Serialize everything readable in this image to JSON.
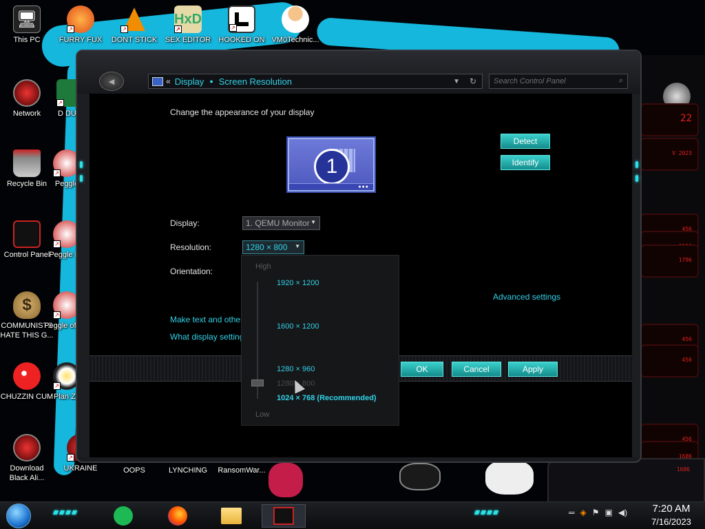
{
  "desktop": {
    "icons": [
      {
        "label": "This PC",
        "icon": "this-pc-icon",
        "glyph": "🖥"
      },
      {
        "label": "FURRY FUX",
        "icon": "firefox-icon",
        "glyph": "🦊"
      },
      {
        "label": "DONT STICK",
        "icon": "vlc-icon",
        "glyph": "🔺"
      },
      {
        "label": "SEX EDITOR",
        "icon": "hxd-icon",
        "glyph": "H"
      },
      {
        "label": "HOOKED ON",
        "icon": "game-icon",
        "glyph": "▞"
      },
      {
        "label": "VM0Technic...",
        "icon": "doctor-icon",
        "glyph": "👨"
      },
      {
        "label": "Network",
        "icon": "network-icon",
        "glyph": "◉"
      },
      {
        "label": "D DUM",
        "icon": "app-icon",
        "glyph": "▣"
      },
      {
        "label": "Recycle Bin",
        "icon": "recycle-bin-icon",
        "glyph": "🗑"
      },
      {
        "label": "Peggle",
        "icon": "peggle-icon",
        "glyph": "◐"
      },
      {
        "label": "Control Panel",
        "icon": "control-panel-icon",
        "glyph": "▤"
      },
      {
        "label": "Peggle De",
        "icon": "peggle-icon",
        "glyph": "◐"
      },
      {
        "label": "COMMUNISTS HATE THIS G...",
        "icon": "money-bag-icon",
        "glyph": "💰"
      },
      {
        "label": "Peggle of Wa",
        "icon": "peggle-icon",
        "glyph": "◐"
      },
      {
        "label": "CHUZZIN CUM",
        "icon": "chuzzle-icon",
        "glyph": "●"
      },
      {
        "label": "Plan Zo",
        "icon": "flower-icon",
        "glyph": "✿"
      },
      {
        "label": "Download Black Ali...",
        "icon": "alien-download-icon",
        "glyph": "◉"
      },
      {
        "label": "UKRAINE",
        "icon": "app-icon",
        "glyph": "▣"
      },
      {
        "label": "OOPS",
        "icon": "app-icon",
        "glyph": ""
      },
      {
        "label": "LYNCHING",
        "icon": "app-icon",
        "glyph": ""
      },
      {
        "label": "RansomWar...",
        "icon": "app-icon",
        "glyph": ""
      }
    ],
    "wallpaper_numbers": [
      "22",
      "V 2023",
      "456",
      "3196",
      "1796",
      "456",
      "456",
      "456",
      "1686",
      "1686"
    ]
  },
  "window": {
    "breadcrumb": [
      "Display",
      "Screen Resolution"
    ],
    "breadcrumb_prefix": "«",
    "search_placeholder": "Search Control Panel",
    "heading": "Change the appearance of your display",
    "monitor_number": "1",
    "detect_label": "Detect",
    "identify_label": "Identify",
    "display_label": "Display:",
    "display_value": "1. QEMU Monitor",
    "resolution_label": "Resolution:",
    "resolution_value": "1280 × 800",
    "orientation_label": "Orientation:",
    "advanced_link": "Advanced settings",
    "link1": "Make text and other",
    "link2": "What display setting",
    "ok_label": "OK",
    "cancel_label": "Cancel",
    "apply_label": "Apply"
  },
  "resolution_popup": {
    "high_label": "High",
    "low_label": "Low",
    "options": [
      "1920 × 1200",
      "1600 × 1200",
      "1280 × 960",
      "1280 × 800",
      "1024 × 768 (Recommended)"
    ],
    "selected": "1280 × 800"
  },
  "taskbar": {
    "apps": [
      "spotify-icon",
      "firefox-icon",
      "file-explorer-icon",
      "control-panel-icon"
    ],
    "time": "7:20 AM",
    "date": "7/16/2023"
  },
  "colors": {
    "accent": "#32d2e8",
    "button": "#1aa8a6",
    "wallpaper_red": "#e0201c"
  }
}
